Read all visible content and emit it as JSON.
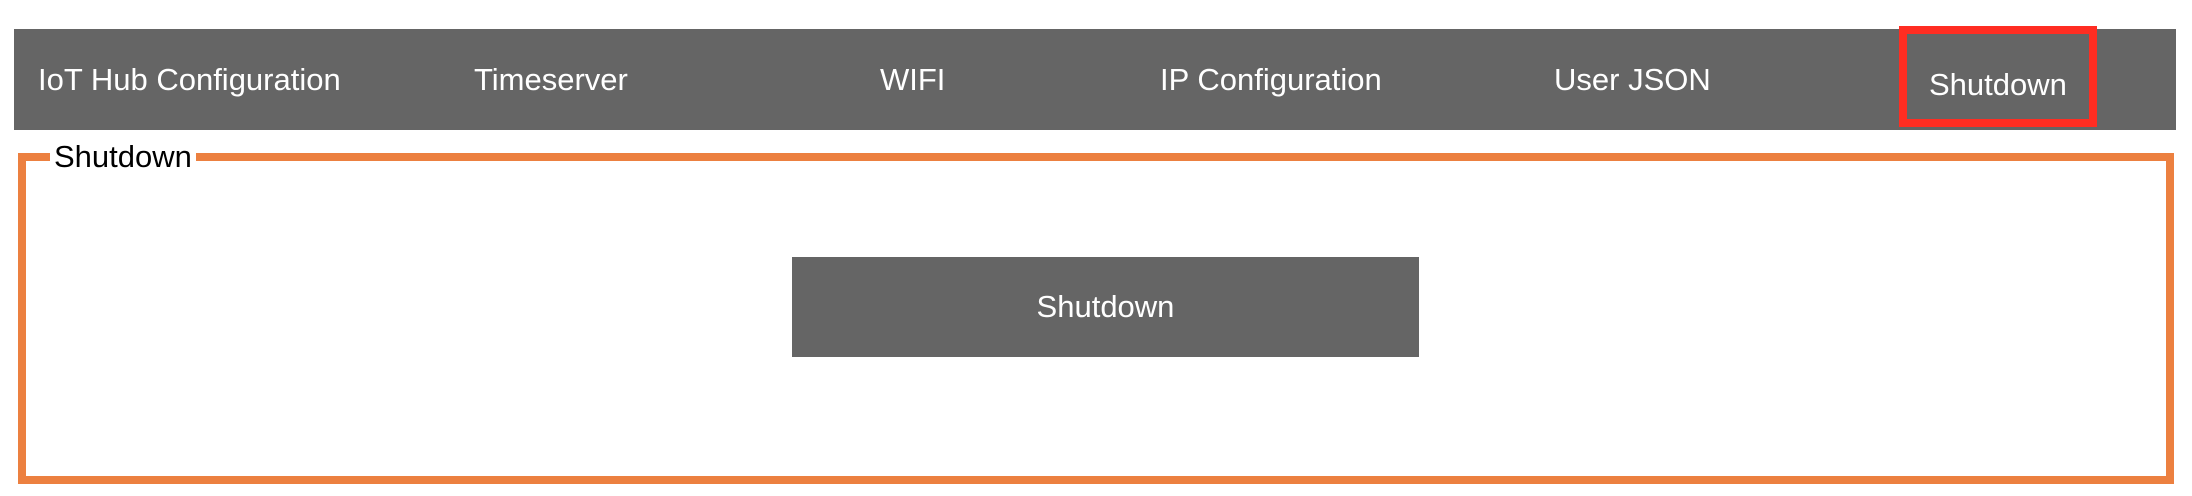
{
  "nav": {
    "items": [
      {
        "label": "IoT Hub Configuration"
      },
      {
        "label": "Timeserver"
      },
      {
        "label": "WIFI"
      },
      {
        "label": "IP Configuration"
      },
      {
        "label": "User JSON"
      },
      {
        "label": "Shutdown",
        "active": true
      }
    ]
  },
  "section": {
    "legend": "Shutdown",
    "button_label": "Shutdown"
  },
  "colors": {
    "nav_background": "#656565",
    "accent_border": "#ec8040",
    "active_highlight": "#ff2d22",
    "button_background": "#656565",
    "text_light": "#ffffff"
  }
}
